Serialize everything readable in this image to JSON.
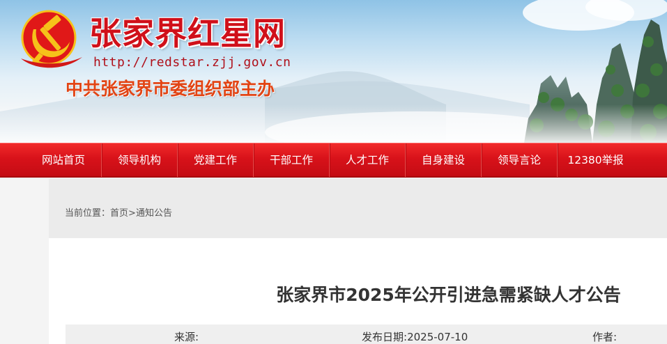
{
  "header": {
    "site_title": "张家界红星网",
    "site_url": "http://redstar.zjj.gov.cn",
    "sponsor": "中共张家界市委组织部主办",
    "emblem_icon": "hammer-sickle-icon",
    "colors": {
      "title": "#d0101a",
      "sponsor": "#e24414",
      "nav": "#d8121a"
    }
  },
  "nav": {
    "items": [
      {
        "label": "网站首页"
      },
      {
        "label": "领导机构"
      },
      {
        "label": "党建工作"
      },
      {
        "label": "干部工作"
      },
      {
        "label": "人才工作"
      },
      {
        "label": "自身建设"
      },
      {
        "label": "领导言论"
      },
      {
        "label": "12380举报"
      }
    ]
  },
  "breadcrumb": {
    "prefix": "当前位置：",
    "home": "首页",
    "separator": ">",
    "current": "通知公告"
  },
  "article": {
    "title": "张家界市2025年公开引进急需紧缺人才公告",
    "source_label": "来源:",
    "date_label": "发布日期:",
    "date_value": "2025-07-10",
    "author_label": "作者:"
  }
}
